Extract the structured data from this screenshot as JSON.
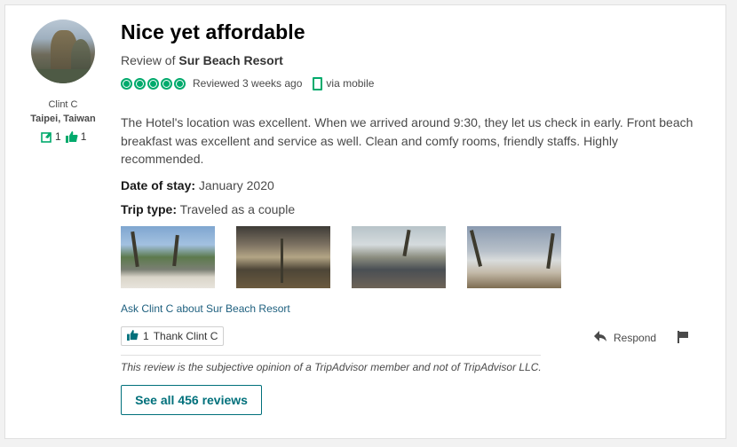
{
  "reviewer": {
    "name": "Clint C",
    "location": "Taipei, Taiwan",
    "contributions": "1",
    "helpful_votes": "1"
  },
  "review": {
    "title": "Nice yet affordable",
    "review_of_prefix": "Review of",
    "hotel_name": "Sur Beach Resort",
    "rating_bubbles": 5,
    "reviewed_when": "Reviewed 3 weeks ago",
    "via": "via mobile",
    "body": "The Hotel's location was excellent. When we arrived around 9:30, they let us check in early. Front beach breakfast was excellent and service as well. Clean and comfy rooms, friendly staffs. Highly recommended.",
    "date_of_stay_label": "Date of stay:",
    "date_of_stay": "January 2020",
    "trip_type_label": "Trip type:",
    "trip_type": "Traveled as a couple",
    "photos": [
      "beach-resort-photo",
      "restaurant-photo",
      "drinks-photo",
      "beach-sunset-photo"
    ]
  },
  "actions": {
    "ask_link": "Ask Clint C about Sur Beach Resort",
    "thank_count": "1",
    "thank_label": "Thank Clint C",
    "respond_label": "Respond",
    "see_all_label": "See all 456 reviews"
  },
  "disclaimer": "This review is the subjective opinion of a TripAdvisor member and not of TripAdvisor LLC.",
  "colors": {
    "accent_green": "#00aa6c",
    "link_blue": "#1d5f7e",
    "teal_button": "#00707b"
  }
}
